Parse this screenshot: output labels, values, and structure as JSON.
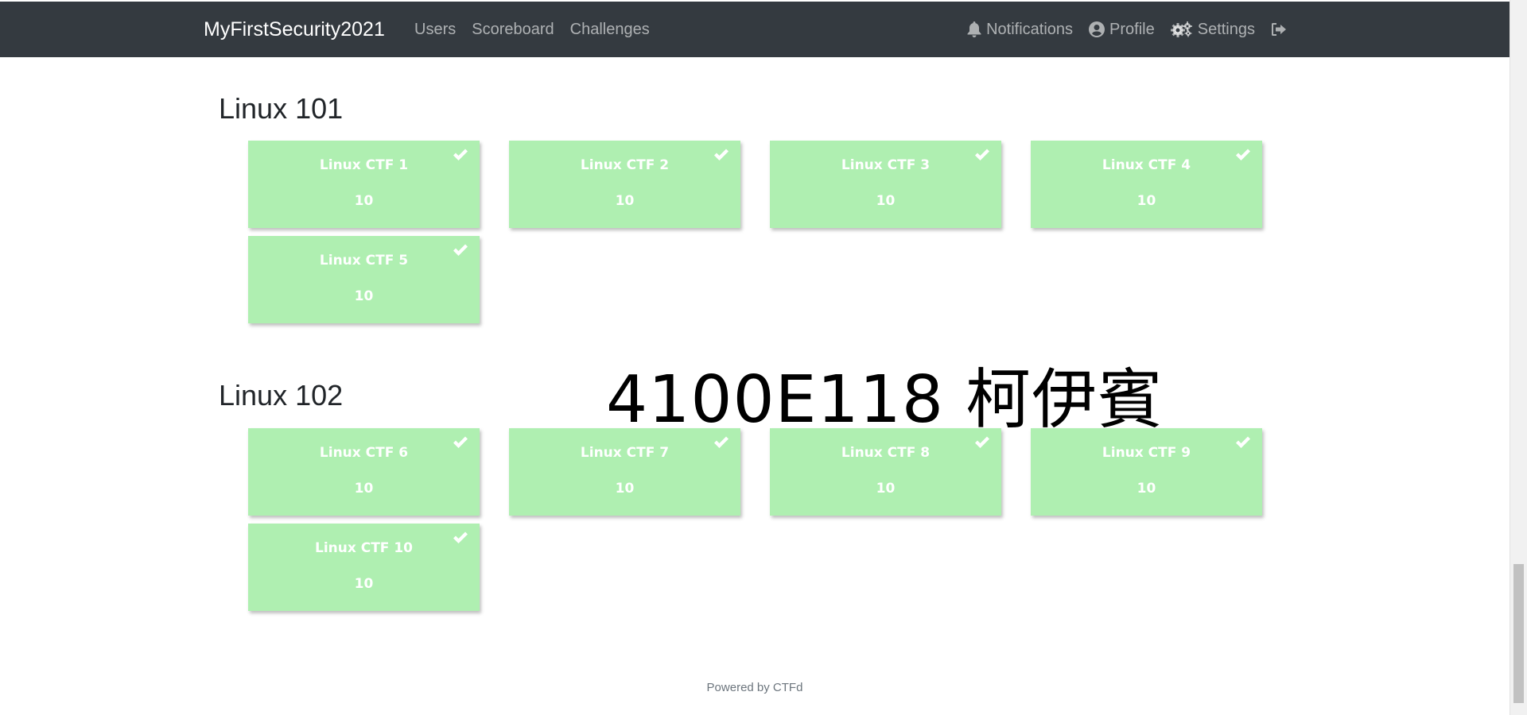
{
  "navbar": {
    "brand": "MyFirstSecurity2021",
    "left_links": [
      {
        "label": "Users"
      },
      {
        "label": "Scoreboard"
      },
      {
        "label": "Challenges"
      }
    ],
    "right_links": [
      {
        "label": "Notifications",
        "icon": "bell-icon"
      },
      {
        "label": "Profile",
        "icon": "user-circle-icon"
      },
      {
        "label": "Settings",
        "icon": "gears-icon"
      }
    ],
    "logout_icon": "sign-out-icon"
  },
  "categories": [
    {
      "name": "Linux 101",
      "challenges": [
        {
          "name": "Linux CTF 1",
          "value": "10",
          "solved": true
        },
        {
          "name": "Linux CTF 2",
          "value": "10",
          "solved": true
        },
        {
          "name": "Linux CTF 3",
          "value": "10",
          "solved": true
        },
        {
          "name": "Linux CTF 4",
          "value": "10",
          "solved": true
        },
        {
          "name": "Linux CTF 5",
          "value": "10",
          "solved": true
        }
      ]
    },
    {
      "name": "Linux 102",
      "challenges": [
        {
          "name": "Linux CTF 6",
          "value": "10",
          "solved": true
        },
        {
          "name": "Linux CTF 7",
          "value": "10",
          "solved": true
        },
        {
          "name": "Linux CTF 8",
          "value": "10",
          "solved": true
        },
        {
          "name": "Linux CTF 9",
          "value": "10",
          "solved": true
        },
        {
          "name": "Linux CTF 10",
          "value": "10",
          "solved": true
        }
      ]
    }
  ],
  "overlay_text": "4100E118 柯伊賓",
  "footer": {
    "text": "Powered by CTFd"
  },
  "colors": {
    "navbar_bg": "#343a40",
    "solved_card_bg": "#afefb1"
  }
}
